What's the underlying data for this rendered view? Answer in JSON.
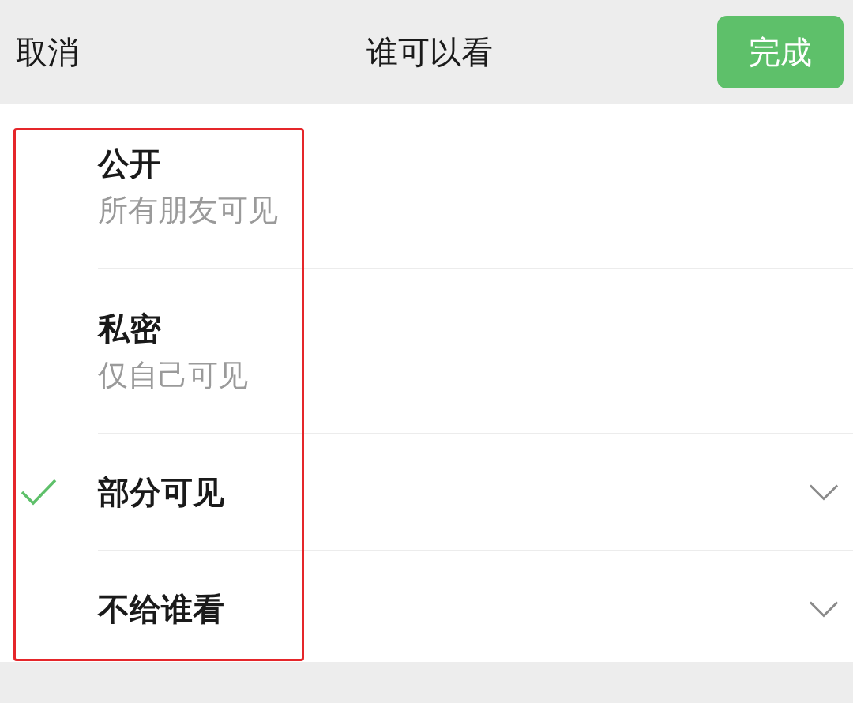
{
  "header": {
    "cancel": "取消",
    "title": "谁可以看",
    "done": "完成"
  },
  "options": [
    {
      "title": "公开",
      "subtitle": "所有朋友可见",
      "selected": false,
      "expandable": false
    },
    {
      "title": "私密",
      "subtitle": "仅自己可见",
      "selected": false,
      "expandable": false
    },
    {
      "title": "部分可见",
      "selected": true,
      "expandable": true
    },
    {
      "title": "不给谁看",
      "selected": false,
      "expandable": true
    }
  ]
}
